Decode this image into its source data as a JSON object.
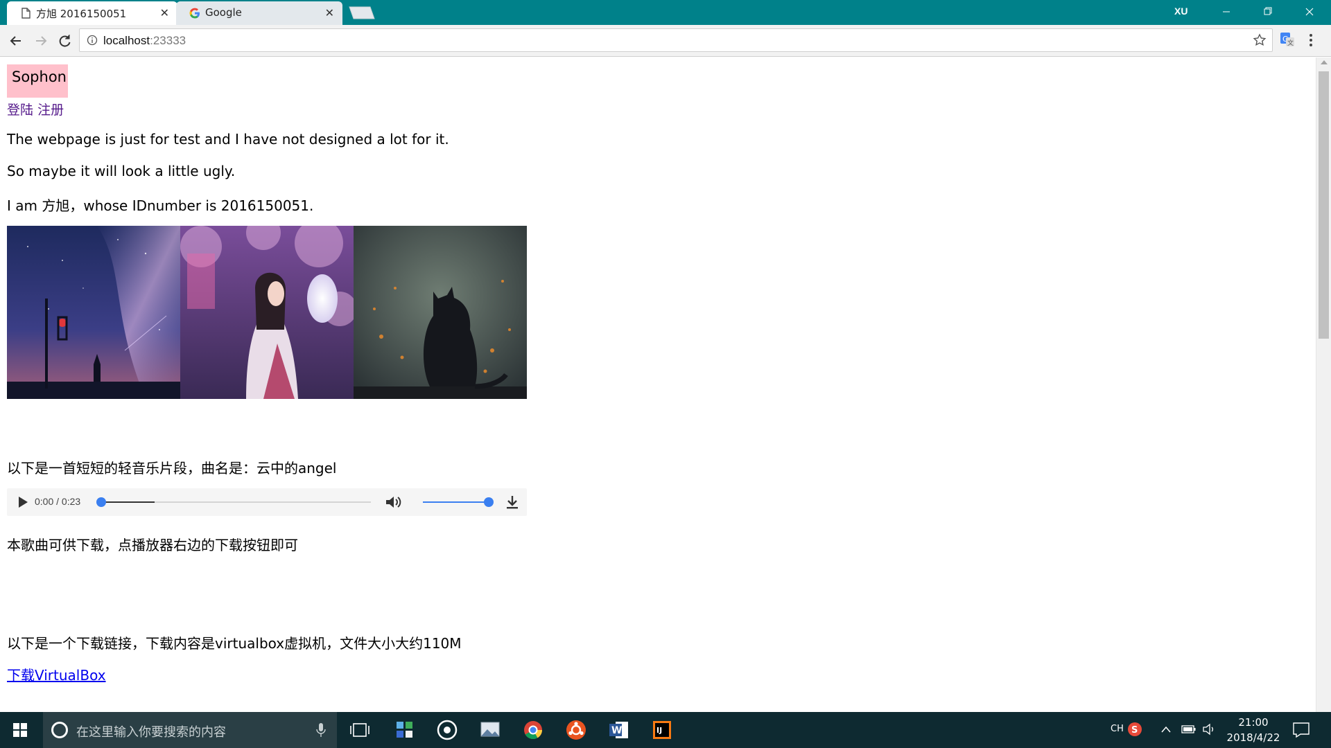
{
  "browser": {
    "tabs": [
      {
        "title": "方旭 2016150051",
        "active": true
      },
      {
        "title": "Google",
        "active": false
      }
    ],
    "user": "XU",
    "url_host": "localhost",
    "url_port": ":23333"
  },
  "page": {
    "logo": "Sophon",
    "login_link": "登陆",
    "register_link": "注册",
    "paragraphs": [
      "The webpage is just for test and I have not designed a lot for it.",
      "So maybe it will look a little ugly.",
      "I am 方旭，whose IDnumber is 2016150051."
    ],
    "music_intro": "以下是一首短短的轻音乐片段，曲名是：云中的angel",
    "audio": {
      "current_time": "0:00",
      "separator": " / ",
      "duration": "0:23",
      "progress": 0,
      "buffered": 0.2,
      "volume": 1.0
    },
    "music_note": "本歌曲可供下载，点播放器右边的下载按钮即可",
    "vbox_intro": "以下是一个下载链接，下载内容是virtualbox虚拟机，文件大小大约110M",
    "vbox_link": "下载VirtualBox"
  },
  "taskbar": {
    "search_placeholder": "在这里输入你要搜索的内容",
    "ime": "CH",
    "time": "21:00",
    "date": "2018/4/22"
  },
  "colors": {
    "chrome_accent": "#00818a",
    "logo_bg": "#ffc0cb",
    "visited_link": "#551a8b",
    "link": "#0000ee",
    "slider": "#3a7ff0"
  }
}
